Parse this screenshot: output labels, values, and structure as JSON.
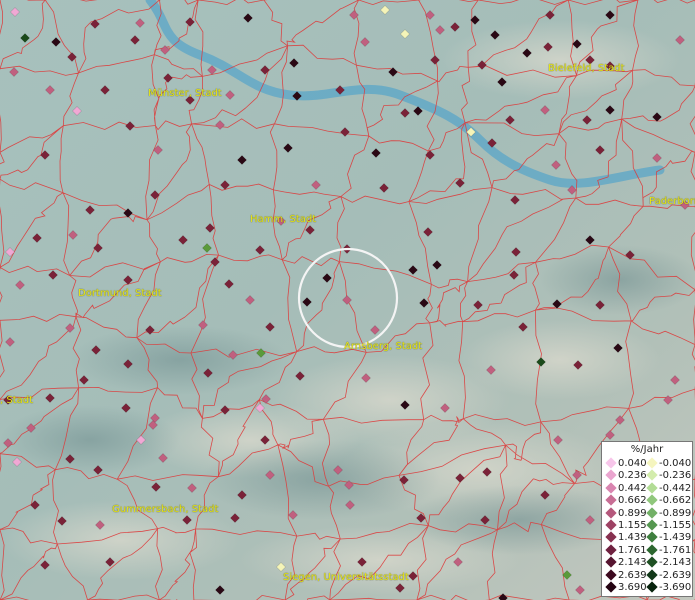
{
  "map": {
    "cities": [
      {
        "label": "Münster, Stadt"
      },
      {
        "label": "Bielefeld, Stadt"
      },
      {
        "label": "Hamm, Stadt"
      },
      {
        "label": "Paderborn"
      },
      {
        "label": "Dortmund, Stadt"
      },
      {
        "label": "Arnsberg, Stadt"
      },
      {
        "label": "Gummersbach, Stadt"
      },
      {
        "label": "Siegen, Universitätsstadt"
      },
      {
        "label": ", Stadt"
      }
    ],
    "marker_categories": {
      "pink": "#f0a8d4",
      "mauve": "#c0607f",
      "darkred": "#7a2238",
      "black": "#2a0814",
      "lightgreen": "#f4f4b8",
      "green": "#5a9a3a",
      "darkgreen": "#1a4a1a"
    },
    "selection_circle": "white ring near Arnsberg"
  },
  "legend": {
    "title": "%/Jahr",
    "positive": [
      {
        "label": "0.040",
        "color": "#f7c6ea"
      },
      {
        "label": "0.236",
        "color": "#eaa5cf"
      },
      {
        "label": "0.442",
        "color": "#d985b0"
      },
      {
        "label": "0.662",
        "color": "#c86e95"
      },
      {
        "label": "0.899",
        "color": "#b5587c"
      },
      {
        "label": "1.155",
        "color": "#9e4264"
      },
      {
        "label": "1.439",
        "color": "#87304f"
      },
      {
        "label": "1.761",
        "color": "#6f2140"
      },
      {
        "label": "2.143",
        "color": "#561530"
      },
      {
        "label": "2.639",
        "color": "#3d0a20"
      },
      {
        "label": "3.690",
        "color": "#240312"
      }
    ],
    "negative": [
      {
        "label": "-0.040",
        "color": "#f5f5bf"
      },
      {
        "label": "-0.236",
        "color": "#d3ecac"
      },
      {
        "label": "-0.442",
        "color": "#b2dc95"
      },
      {
        "label": "-0.662",
        "color": "#90c77c"
      },
      {
        "label": "-0.899",
        "color": "#72b066"
      },
      {
        "label": "-1.155",
        "color": "#559750"
      },
      {
        "label": "-1.439",
        "color": "#3e7f3e"
      },
      {
        "label": "-1.761",
        "color": "#2c672f"
      },
      {
        "label": "-2.143",
        "color": "#1e5023"
      },
      {
        "label": "-2.639",
        "color": "#123919"
      },
      {
        "label": "-3.690",
        "color": "#07230d"
      }
    ]
  }
}
